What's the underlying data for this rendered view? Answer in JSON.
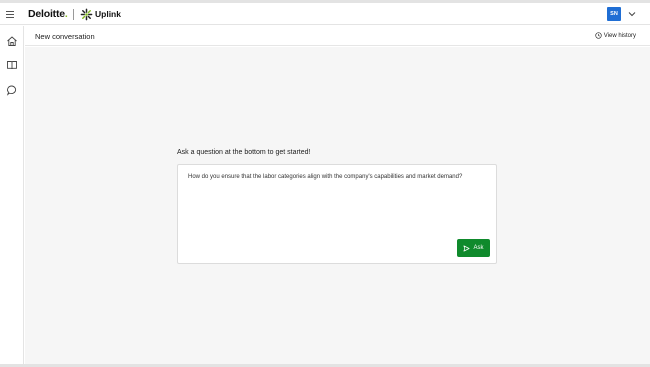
{
  "header": {
    "brand_word": "Deloitte",
    "brand_dot": ".",
    "app_name": "Uplink",
    "avatar_initials": "SN",
    "accent_color": "#1f6ed4",
    "brand_green": "#86bc25"
  },
  "sidebar": {
    "items": [
      {
        "name": "home",
        "icon": "home-icon"
      },
      {
        "name": "library",
        "icon": "book-icon"
      },
      {
        "name": "chat",
        "icon": "chat-icon"
      }
    ]
  },
  "subheader": {
    "title": "New conversation",
    "view_history_label": "View history"
  },
  "main": {
    "prompt_label": "Ask a question at the bottom to get started!",
    "question_text": "How do you ensure that the labor categories align with the company's capabilities and market demand?",
    "ask_label": "Ask",
    "ask_color": "#0f8a2c"
  }
}
